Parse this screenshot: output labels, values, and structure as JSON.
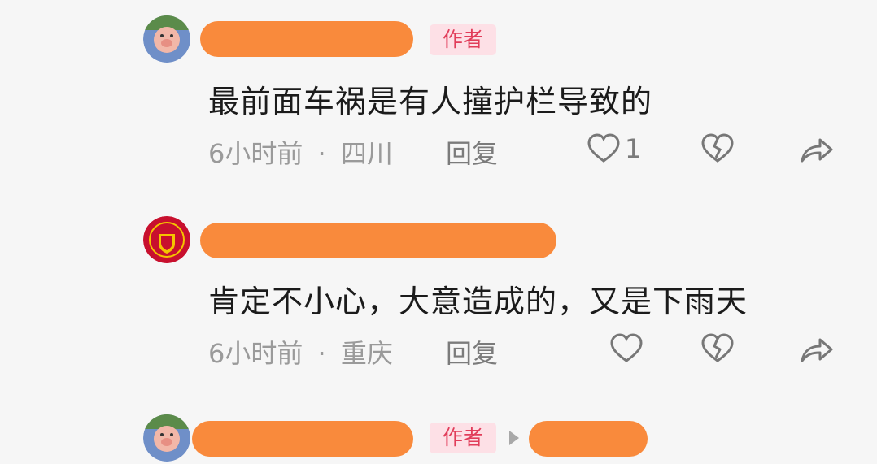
{
  "comments": [
    {
      "avatar": "cartoon-pig-avatar",
      "author_badge": "作者",
      "text": "最前面车祸是有人撞护栏导致的",
      "time": "6小时前",
      "location": "四川",
      "reply_label": "回复",
      "likes": "1"
    },
    {
      "avatar": "manchester-united-crest-avatar",
      "text": "肯定不小心，大意造成的，又是下雨天",
      "time": "6小时前",
      "location": "重庆",
      "reply_label": "回复",
      "likes": ""
    },
    {
      "avatar": "cartoon-pig-avatar",
      "author_badge": "作者"
    }
  ],
  "meta_separator": "·",
  "colors": {
    "redaction": "#f98a3c",
    "badge_bg": "#fde0e6",
    "badge_text": "#e13d5a",
    "meta_text": "#9a9a9a"
  }
}
